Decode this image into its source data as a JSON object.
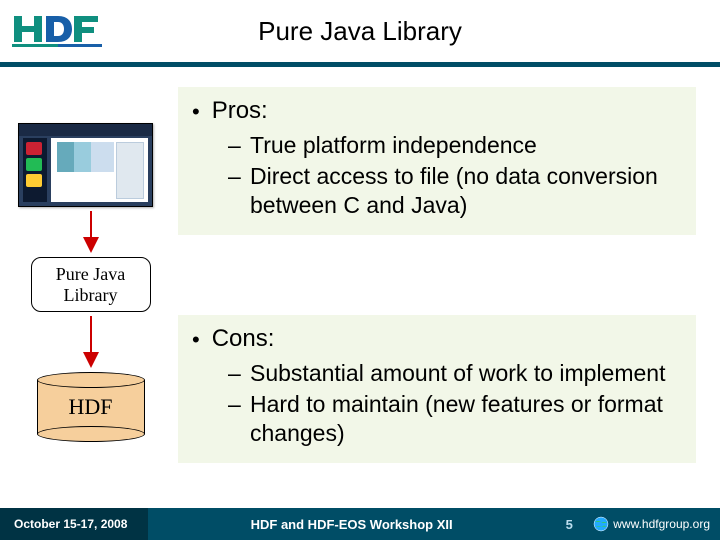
{
  "header": {
    "title": "Pure Java Library"
  },
  "diagram": {
    "pjl_label_line1": "Pure Java",
    "pjl_label_line2": "Library",
    "hdf_label": "HDF"
  },
  "pros": {
    "heading": "Pros:",
    "items": [
      "True platform independence",
      "Direct access to file (no data conversion between C and Java)"
    ]
  },
  "cons": {
    "heading": "Cons:",
    "items": [
      "Substantial amount of work to implement",
      "Hard to maintain (new features or format changes)"
    ]
  },
  "footer": {
    "date": "October 15-17, 2008",
    "workshop": "HDF and HDF-EOS Workshop XII",
    "page": "5",
    "url": "www.hdfgroup.org"
  }
}
